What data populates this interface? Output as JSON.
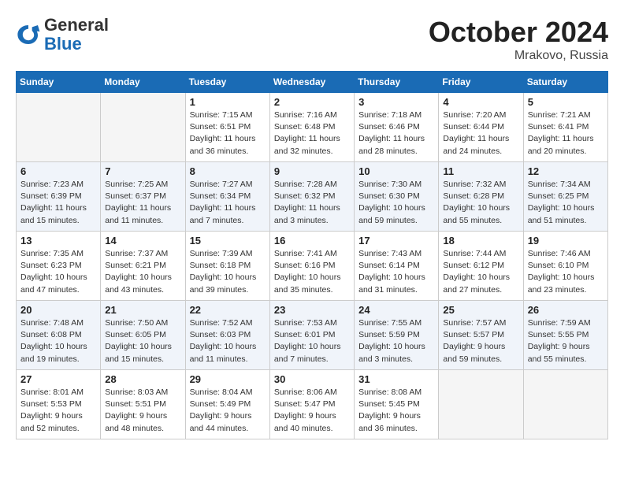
{
  "header": {
    "logo_general": "General",
    "logo_blue": "Blue",
    "month_title": "October 2024",
    "location": "Mrakovo, Russia"
  },
  "days_of_week": [
    "Sunday",
    "Monday",
    "Tuesday",
    "Wednesday",
    "Thursday",
    "Friday",
    "Saturday"
  ],
  "weeks": [
    [
      {
        "day": "",
        "info": ""
      },
      {
        "day": "",
        "info": ""
      },
      {
        "day": "1",
        "info": "Sunrise: 7:15 AM\nSunset: 6:51 PM\nDaylight: 11 hours\nand 36 minutes."
      },
      {
        "day": "2",
        "info": "Sunrise: 7:16 AM\nSunset: 6:48 PM\nDaylight: 11 hours\nand 32 minutes."
      },
      {
        "day": "3",
        "info": "Sunrise: 7:18 AM\nSunset: 6:46 PM\nDaylight: 11 hours\nand 28 minutes."
      },
      {
        "day": "4",
        "info": "Sunrise: 7:20 AM\nSunset: 6:44 PM\nDaylight: 11 hours\nand 24 minutes."
      },
      {
        "day": "5",
        "info": "Sunrise: 7:21 AM\nSunset: 6:41 PM\nDaylight: 11 hours\nand 20 minutes."
      }
    ],
    [
      {
        "day": "6",
        "info": "Sunrise: 7:23 AM\nSunset: 6:39 PM\nDaylight: 11 hours\nand 15 minutes."
      },
      {
        "day": "7",
        "info": "Sunrise: 7:25 AM\nSunset: 6:37 PM\nDaylight: 11 hours\nand 11 minutes."
      },
      {
        "day": "8",
        "info": "Sunrise: 7:27 AM\nSunset: 6:34 PM\nDaylight: 11 hours\nand 7 minutes."
      },
      {
        "day": "9",
        "info": "Sunrise: 7:28 AM\nSunset: 6:32 PM\nDaylight: 11 hours\nand 3 minutes."
      },
      {
        "day": "10",
        "info": "Sunrise: 7:30 AM\nSunset: 6:30 PM\nDaylight: 10 hours\nand 59 minutes."
      },
      {
        "day": "11",
        "info": "Sunrise: 7:32 AM\nSunset: 6:28 PM\nDaylight: 10 hours\nand 55 minutes."
      },
      {
        "day": "12",
        "info": "Sunrise: 7:34 AM\nSunset: 6:25 PM\nDaylight: 10 hours\nand 51 minutes."
      }
    ],
    [
      {
        "day": "13",
        "info": "Sunrise: 7:35 AM\nSunset: 6:23 PM\nDaylight: 10 hours\nand 47 minutes."
      },
      {
        "day": "14",
        "info": "Sunrise: 7:37 AM\nSunset: 6:21 PM\nDaylight: 10 hours\nand 43 minutes."
      },
      {
        "day": "15",
        "info": "Sunrise: 7:39 AM\nSunset: 6:18 PM\nDaylight: 10 hours\nand 39 minutes."
      },
      {
        "day": "16",
        "info": "Sunrise: 7:41 AM\nSunset: 6:16 PM\nDaylight: 10 hours\nand 35 minutes."
      },
      {
        "day": "17",
        "info": "Sunrise: 7:43 AM\nSunset: 6:14 PM\nDaylight: 10 hours\nand 31 minutes."
      },
      {
        "day": "18",
        "info": "Sunrise: 7:44 AM\nSunset: 6:12 PM\nDaylight: 10 hours\nand 27 minutes."
      },
      {
        "day": "19",
        "info": "Sunrise: 7:46 AM\nSunset: 6:10 PM\nDaylight: 10 hours\nand 23 minutes."
      }
    ],
    [
      {
        "day": "20",
        "info": "Sunrise: 7:48 AM\nSunset: 6:08 PM\nDaylight: 10 hours\nand 19 minutes."
      },
      {
        "day": "21",
        "info": "Sunrise: 7:50 AM\nSunset: 6:05 PM\nDaylight: 10 hours\nand 15 minutes."
      },
      {
        "day": "22",
        "info": "Sunrise: 7:52 AM\nSunset: 6:03 PM\nDaylight: 10 hours\nand 11 minutes."
      },
      {
        "day": "23",
        "info": "Sunrise: 7:53 AM\nSunset: 6:01 PM\nDaylight: 10 hours\nand 7 minutes."
      },
      {
        "day": "24",
        "info": "Sunrise: 7:55 AM\nSunset: 5:59 PM\nDaylight: 10 hours\nand 3 minutes."
      },
      {
        "day": "25",
        "info": "Sunrise: 7:57 AM\nSunset: 5:57 PM\nDaylight: 9 hours\nand 59 minutes."
      },
      {
        "day": "26",
        "info": "Sunrise: 7:59 AM\nSunset: 5:55 PM\nDaylight: 9 hours\nand 55 minutes."
      }
    ],
    [
      {
        "day": "27",
        "info": "Sunrise: 8:01 AM\nSunset: 5:53 PM\nDaylight: 9 hours\nand 52 minutes."
      },
      {
        "day": "28",
        "info": "Sunrise: 8:03 AM\nSunset: 5:51 PM\nDaylight: 9 hours\nand 48 minutes."
      },
      {
        "day": "29",
        "info": "Sunrise: 8:04 AM\nSunset: 5:49 PM\nDaylight: 9 hours\nand 44 minutes."
      },
      {
        "day": "30",
        "info": "Sunrise: 8:06 AM\nSunset: 5:47 PM\nDaylight: 9 hours\nand 40 minutes."
      },
      {
        "day": "31",
        "info": "Sunrise: 8:08 AM\nSunset: 5:45 PM\nDaylight: 9 hours\nand 36 minutes."
      },
      {
        "day": "",
        "info": ""
      },
      {
        "day": "",
        "info": ""
      }
    ]
  ]
}
